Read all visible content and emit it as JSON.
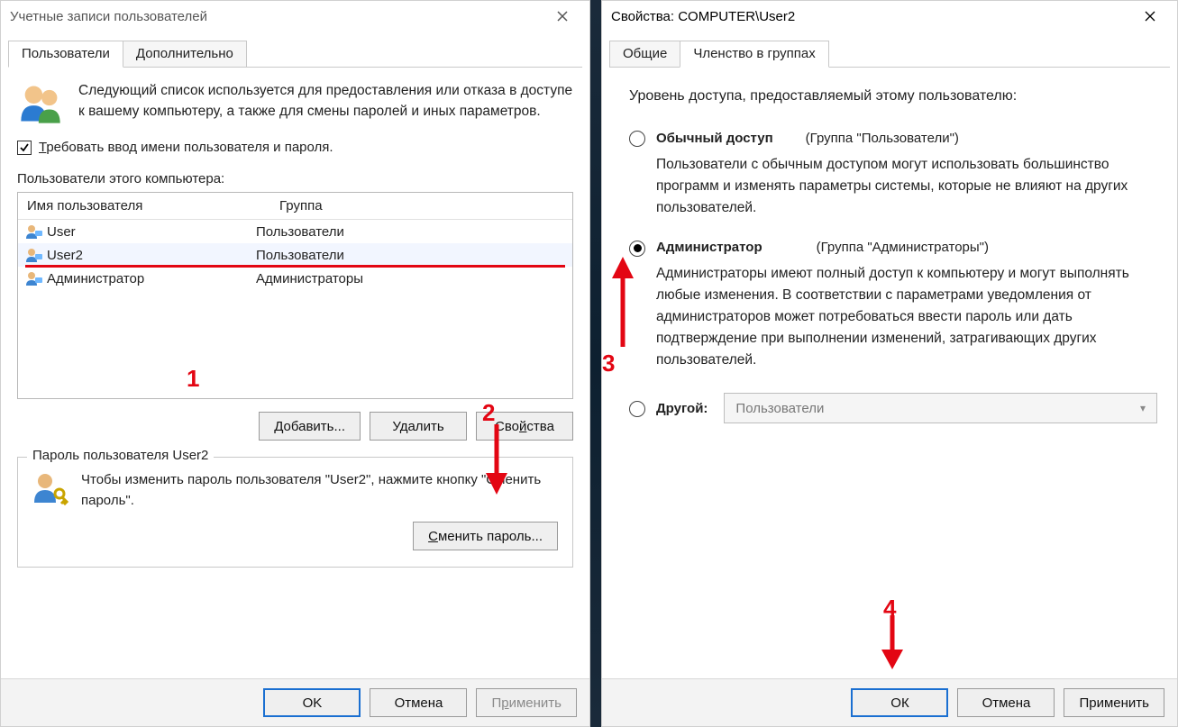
{
  "left": {
    "title": "Учетные записи пользователей",
    "tabs": {
      "users": "Пользователи",
      "advanced": "Дополнительно"
    },
    "intro": "Следующий список используется для предоставления или отказа в доступе к вашему компьютеру, а также для смены паролей и иных параметров.",
    "checkbox_label": "ребовать ввод имени пользователя и пароля.",
    "checkbox_underline": "Т",
    "list_label": "Пользователи этого компьютера:",
    "columns": {
      "name": "Имя пользователя",
      "group": "Группа"
    },
    "rows": [
      {
        "name": "User",
        "group": "Пользователи"
      },
      {
        "name": "User2",
        "group": "Пользователи",
        "selected": true
      },
      {
        "name": "Администратор",
        "group": "Администраторы"
      }
    ],
    "buttons": {
      "add": "Добавить...",
      "remove": "Удалить",
      "props": "Свойства"
    },
    "pwbox": {
      "title": "Пароль пользователя User2",
      "text": "Чтобы изменить пароль пользователя \"User2\", нажмите кнопку \"Сменить пароль\".",
      "button": "Сменить пароль..."
    },
    "footer": {
      "ok": "OK",
      "cancel": "Отмена",
      "apply": "Применить"
    }
  },
  "right": {
    "title": "Свойства: COMPUTER\\User2",
    "tabs": {
      "general": "Общие",
      "membership": "Членство в группах"
    },
    "access_label": "Уровень доступа, предоставляемый этому пользователю:",
    "opt1": {
      "title": "Обычный доступ",
      "group": "(Группа \"Пользователи\")",
      "desc": "Пользователи с обычным доступом могут использовать большинство программ и изменять параметры системы, которые не влияют на других пользователей."
    },
    "opt2": {
      "title": "Администратор",
      "group": "(Группа \"Администраторы\")",
      "desc": "Администраторы имеют полный доступ к компьютеру и могут выполнять любые изменения. В соответствии с параметрами уведомления от администраторов может потребоваться ввести пароль или дать подтверждение при выполнении изменений, затрагивающих других пользователей."
    },
    "opt3": {
      "title": "Другой:",
      "combo": "Пользователи"
    },
    "footer": {
      "ok": "ОК",
      "cancel": "Отмена",
      "apply": "Применить"
    }
  },
  "annotations": {
    "n1": "1",
    "n2": "2",
    "n3": "3",
    "n4": "4"
  }
}
